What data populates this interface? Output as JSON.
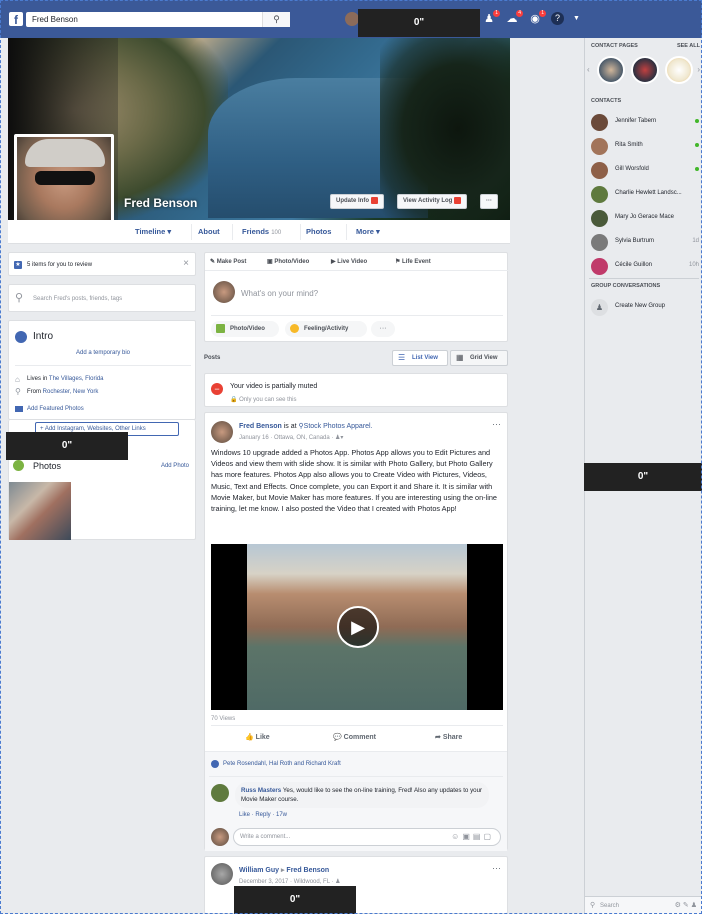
{
  "topbar": {
    "search_value": "Fred Benson",
    "badges": [
      "1",
      "4",
      "1"
    ]
  },
  "gaps": {
    "label": "0\""
  },
  "cover": {
    "name": "Fred Benson",
    "update_info": "Update Info",
    "activity_log": "View Activity Log",
    "more": "···"
  },
  "timeline_nav": {
    "timeline": "Timeline ▾",
    "about": "About",
    "friends": "Friends",
    "friends_count": "100",
    "photos": "Photos",
    "more": "More ▾"
  },
  "left": {
    "review_text": "5 items for you to review",
    "search_placeholder": "Search Fred's posts, friends, tags",
    "intro_title": "Intro",
    "add_bio": "Add a temporary bio",
    "lives_prefix": "Lives in ",
    "lives_place": "The Villages, Florida",
    "from_prefix": "From ",
    "from_place": "Rochester, New York",
    "featured": "Add Featured Photos",
    "add_links": "+ Add Instagram, Websites, Other Links",
    "photos_title": "Photos",
    "add_photo": "Add Photo"
  },
  "composer": {
    "make_post": "Make Post",
    "photo_video": "Photo/Video",
    "live_video": "Live Video",
    "life_event": "Life Event",
    "placeholder": "What's on your mind?",
    "btn_photo": "Photo/Video",
    "btn_feeling": "Feeling/Activity",
    "btn_more": "···"
  },
  "posts_bar": {
    "label": "Posts",
    "list_view": "List View",
    "grid_view": "Grid View"
  },
  "muted": {
    "title": "Your video is partially muted",
    "sub": "Only you can see this"
  },
  "post": {
    "author": "Fred Benson",
    "is_at": " is at ",
    "place": "Stock Photos Apparel.",
    "meta": "January 16 · Ottawa, ON, Canada · ",
    "text": "Windows 10 upgrade added a Photos App. Photos App allows you to Edit Pictures and Videos and view them with slide show. It is similar with Photo Gallery, but Photo Gallery has more features. Photos App also allows you to Create Video with Pictures, Videos, Music, Text and Effects. Once complete, you can Export it and Share it. It is similar with Movie Maker, but Movie Maker has more features. If you are interesting using the on-line training, let me know. I also posted the Video that I created with Photos App!",
    "views": "70 Views",
    "like": "Like",
    "comment": "Comment",
    "share": "Share",
    "reactions": "Pete Rosendahl, Hal Roth and Richard Kraft",
    "comment_author": "Russ Masters",
    "comment_text": " Yes, would like to see the on-line training, Fred! Also any updates to your Movie Maker course.",
    "comment_actions": "Like · Reply · 17w",
    "write_comment": "Write a comment..."
  },
  "post2": {
    "author": "William Guy",
    "arrow": " ▸ ",
    "target": "Fred Benson",
    "meta": "December 3, 2017 · Wildwood, FL · "
  },
  "sidebar": {
    "contact_pages": "CONTACT PAGES",
    "see_all": "SEE ALL",
    "contacts": "CONTACTS",
    "contacts_list": [
      {
        "name": "Jennifer Tabern",
        "status": "online",
        "color": "#6b4a3a"
      },
      {
        "name": "Rita Smith",
        "status": "online",
        "color": "#a2745a"
      },
      {
        "name": "Gill Worsfold",
        "status": "online",
        "color": "#8e6048"
      },
      {
        "name": "Charlie Hewlett Landsc...",
        "status": "",
        "color": "#5f7a3e"
      },
      {
        "name": "Mary Jo Gerace Mace",
        "status": "",
        "color": "#4a5a3a"
      },
      {
        "name": "Sylvia Burtrum",
        "status": "1d",
        "color": "#7a7a7a"
      },
      {
        "name": "Cécile Guillon",
        "status": "10h",
        "color": "#c03a6a"
      }
    ],
    "group_conversations": "GROUP CONVERSATIONS",
    "create_group": "Create New Group",
    "search": "Search"
  }
}
